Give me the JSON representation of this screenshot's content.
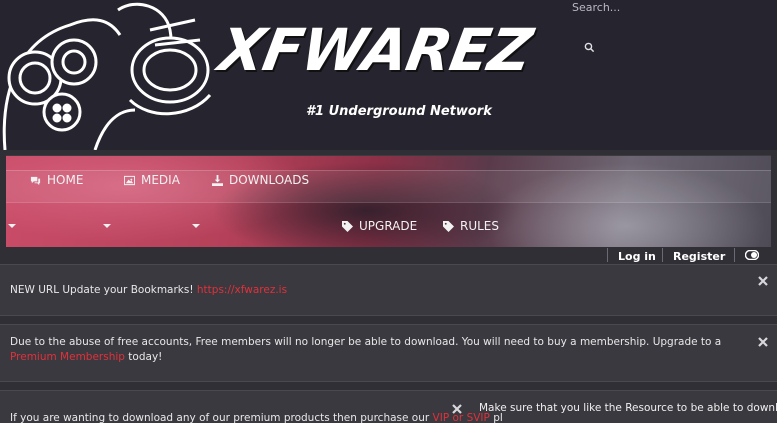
{
  "header": {
    "logo_text": "XFWAREZ",
    "tagline": "#1 Underground Network",
    "search_placeholder": "Search..."
  },
  "nav": {
    "items": [
      {
        "label": "HOME",
        "icon": "comments-icon"
      },
      {
        "label": "MEDIA",
        "icon": "image-icon"
      },
      {
        "label": "DOWNLOADS",
        "icon": "download-icon"
      },
      {
        "label": "UPGRADE",
        "icon": "tag-icon"
      },
      {
        "label": "RULES",
        "icon": "tag-icon"
      }
    ]
  },
  "userbar": {
    "login": "Log in",
    "register": "Register"
  },
  "notices": {
    "n1_text": "NEW URL Update your Bookmarks! ",
    "n1_link": "https://xfwarez.is",
    "n2_text": "Due to the abuse of free accounts, Free members will no longer be able to download. You will need to buy a membership. Upgrade to a ",
    "n2_link": "Premium Membership",
    "n2_suffix": " today!",
    "n3_text": "If you are wanting to download any of our premium products then purchase our ",
    "n3_link": "VIP or SVIP",
    "n3_suffix": " pl",
    "n4_text": "Make sure that you like the Resource to be able to download"
  },
  "colors": {
    "page_bg": "#2f2f35",
    "header_bg": "#26252f",
    "accent_link": "#e0313b",
    "notice_bg": "#3a393f"
  }
}
